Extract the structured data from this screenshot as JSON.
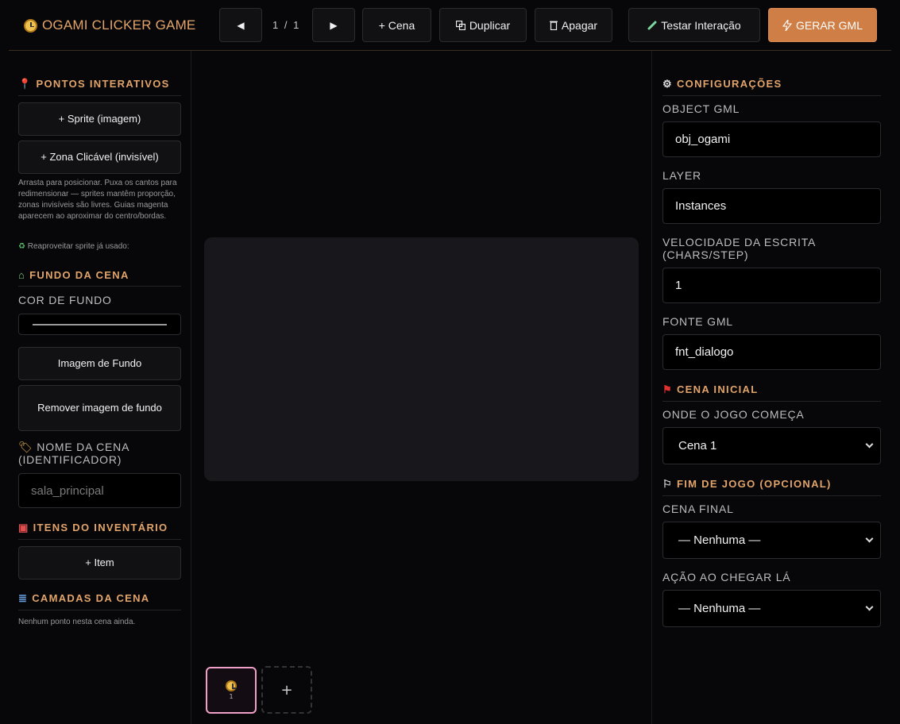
{
  "app": {
    "title": "OGAMI CLICKER GAME",
    "accent": "#e2a46a",
    "generate_color": "#cf7f45"
  },
  "toolbar": {
    "prev_icon": "◀",
    "page_current": "1",
    "page_sep": "/",
    "page_total": "1",
    "next_icon": "▶",
    "add_scene": "+ Cena",
    "duplicate": "Duplicar",
    "delete": "Apagar",
    "test": "Testar Interação",
    "generate": "GERAR GML"
  },
  "left": {
    "interactive_title": "PONTOS INTERATIVOS",
    "add_sprite": "+ Sprite (imagem)",
    "add_zone": "+ Zona Clicável (invisível)",
    "hint": "Arrasta para posicionar. Puxa os cantos para redimensionar — sprites mantêm proporção, zonas invisíveis são livres. Guias magenta aparecem ao aproximar do centro/bordas.",
    "reuse_hint": "Reaproveitar sprite já usado:",
    "background_title": "FUNDO DA CENA",
    "bg_color_label": "COR DE FUNDO",
    "bg_image": "Imagem de Fundo",
    "remove_bg": "Remover imagem de fundo",
    "scene_name_label": "NOME DA CENA (IDENTIFICADOR)",
    "scene_name_placeholder": "sala_principal",
    "inventory_title": "ITENS DO INVENTÁRIO",
    "add_item": "+ Item",
    "layers_title": "CAMADAS DA CENA",
    "layers_empty": "Nenhum ponto nesta cena ainda."
  },
  "right": {
    "config_title": "CONFIGURAÇÕES",
    "object_label": "OBJECT GML",
    "object_value": "obj_ogami",
    "layer_label": "LAYER",
    "layer_value": "Instances",
    "speed_label": "VELOCIDADE DA ESCRITA (CHARS/STEP)",
    "speed_value": "1",
    "font_label": "FONTE GML",
    "font_value": "fnt_dialogo",
    "initial_title": "CENA INICIAL",
    "start_label": "ONDE O JOGO COMEÇA",
    "start_value": "Cena 1",
    "end_title": "FIM DE JOGO (OPCIONAL)",
    "final_label": "CENA FINAL",
    "final_value": "— Nenhuma —",
    "action_label": "AÇÃO AO CHEGAR LÁ",
    "action_value": "— Nenhuma —"
  },
  "scenes": {
    "thumb_number": "1",
    "add_icon": "+"
  }
}
